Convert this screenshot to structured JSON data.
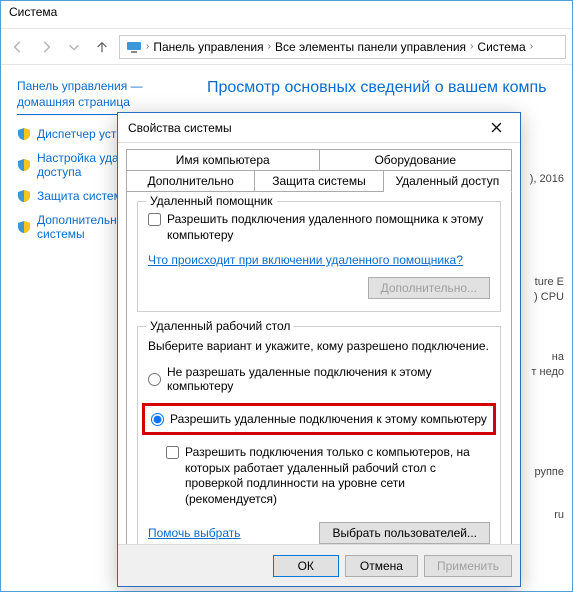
{
  "bg": {
    "title": "Система",
    "breadcrumb": [
      "Панель управления",
      "Все элементы панели управления",
      "Система"
    ],
    "side_header": "Панель управления — домашняя страница",
    "side_items": [
      "Диспетчер устр",
      "Настройка удал\nдоступа",
      "Защита систем",
      "Дополнительны\nсистемы"
    ],
    "main_header": "Просмотр основных сведений о вашем компь",
    "right_fragments": {
      "year": "), 2016",
      "ture": "ture E",
      "cpu": ") CPU",
      "na": "на",
      "nedo": "т недо",
      "rupp": "руппе",
      "ru": "ru"
    }
  },
  "dlg": {
    "title": "Свойства системы",
    "tabs_row1": [
      "Имя компьютера",
      "Оборудование"
    ],
    "tabs_row2": [
      "Дополнительно",
      "Защита системы",
      "Удаленный доступ"
    ],
    "group1": {
      "title": "Удаленный помощник",
      "check_label": "Разрешить подключения удаленного помощника к этому компьютеру",
      "link": "Что происходит при включении удаленного помощника?",
      "btn": "Дополнительно..."
    },
    "group2": {
      "title": "Удаленный рабочий стол",
      "desc": "Выберите вариант и укажите, кому разрешено подключение.",
      "radio1": "Не разрешать удаленные подключения к этому компьютеру",
      "radio2": "Разрешить удаленные подключения к этому компьютеру",
      "subcheck": "Разрешить подключения только с компьютеров, на которых работает удаленный рабочий стол с проверкой подлинности на уровне сети (рекомендуется)",
      "help": "Помочь выбрать",
      "select_users": "Выбрать пользователей..."
    },
    "buttons": {
      "ok": "ОК",
      "cancel": "Отмена",
      "apply": "Применить"
    }
  }
}
